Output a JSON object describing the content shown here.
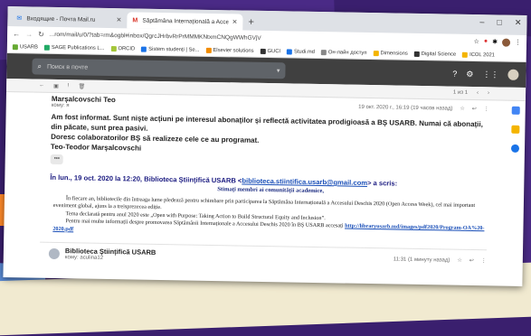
{
  "tabs": [
    {
      "label": "Входящие - Почта Mail.ru",
      "fav": "✉",
      "favcolor": "#1a73e8"
    },
    {
      "label": "Săptămâna Internațională a Acce",
      "fav": "M",
      "favcolor": "#d93025"
    }
  ],
  "url": "...rom/mail/u/0/?tab=rm&ogbl#inbox/QgrcJHrbvRrPrMMMKNtxmCNQgWWhGVjV",
  "bookmarks": [
    {
      "label": "USARB",
      "color": "#6a3"
    },
    {
      "label": "SAGE Publications L...",
      "color": "#2a6"
    },
    {
      "label": "ORCID",
      "color": "#a4c639"
    },
    {
      "label": "Sistem studenți | Se...",
      "color": "#1a73e8"
    },
    {
      "label": "Elsevier solutions",
      "color": "#f28c00"
    },
    {
      "label": "GUCI",
      "color": "#333"
    },
    {
      "label": "Studi.md",
      "color": "#1a73e8"
    },
    {
      "label": "Он-лайн доступ",
      "color": "#888"
    },
    {
      "label": "Dimensions",
      "color": "#f4b400"
    },
    {
      "label": "Digital Science",
      "color": "#333"
    },
    {
      "label": "ICOL 2021",
      "color": "#f4b400"
    }
  ],
  "search_placeholder": "Поиск в почте",
  "pagination": "1 из 1",
  "email1": {
    "sender": "Marșalcovschi Teo",
    "to": "кому: я",
    "date": "19 окт. 2020 г., 16:19 (19 часов назад)",
    "body_line1": "Am fost informat. Sunt niște acțiuni pe interesul abonaților și reflectă activitatea prodigioasă a BȘ USARB. Numai că abonații, din păcate, sunt prea pasivi.",
    "body_line2": "Doresc colaboratorilor BȘ să realizeze cele ce au programat.",
    "signature": "Teo-Teodor Marșalcovschi",
    "ellipsis": "•••"
  },
  "quote": {
    "head_prefix": "În lun., 19 oct. 2020 la 12:20, Biblioteca Științifică USARB <",
    "email": "biblioteca.stiintifica.usarb@gmail.com",
    "head_suffix": "> a scris:",
    "greeting": "Stimați membri ai comunității academice,",
    "p1": "În fiecare an, bibliotecile din întreaga lume pledează pentru schimbare prin participarea la Săptămâna Internațională a Accesului Deschis 2020 (Open Access Week), cel mai important eveniment global, ajuns la a treisprezecea ediție.",
    "p2": "Tema declarată pentru anul 2020 este „Open with Purpose: Taking Action to Build Structural Equity and Inclusion”.",
    "p3": "Pentru mai multe informații despre promovarea Săptămânii Internaționale a Accesului Deschis 2020 în BȘ USARB accesați",
    "link": "http://libraryusarb.md/images/pdf2020/Program-OA%20-2020.pdf"
  },
  "email2": {
    "sender": "Biblioteca Științifică USARB",
    "to": "кому: aculina12",
    "date": "11:31 (1 минуту назад)"
  }
}
